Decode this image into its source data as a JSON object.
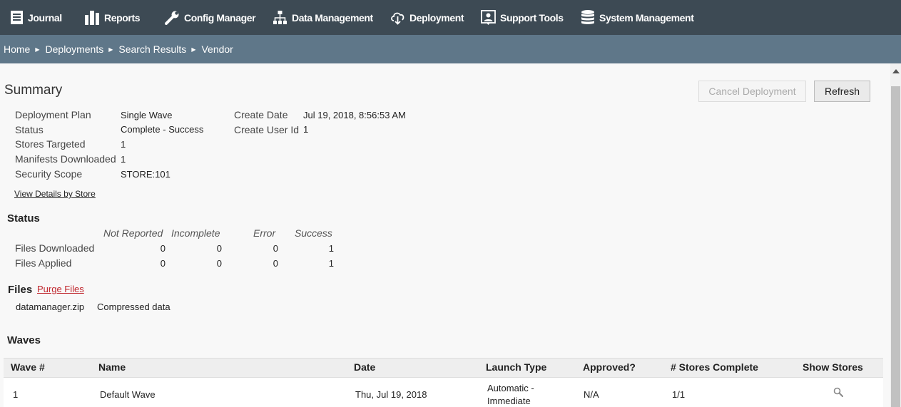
{
  "nav": {
    "items": [
      {
        "label": "Journal",
        "icon": "journal-icon"
      },
      {
        "label": "Reports",
        "icon": "reports-icon"
      },
      {
        "label": "Config Manager",
        "icon": "wrench-icon"
      },
      {
        "label": "Data Management",
        "icon": "hierarchy-icon"
      },
      {
        "label": "Deployment",
        "icon": "cloud-download-icon"
      },
      {
        "label": "Support Tools",
        "icon": "support-icon"
      },
      {
        "label": "System Management",
        "icon": "database-icon"
      }
    ]
  },
  "breadcrumb": [
    "Home",
    "Deployments",
    "Search Results",
    "Vendor"
  ],
  "summary": {
    "title": "Summary",
    "cancel_label": "Cancel Deployment",
    "refresh_label": "Refresh",
    "fields": [
      {
        "label": "Deployment Plan",
        "value": "Single Wave"
      },
      {
        "label": "Status",
        "value": "Complete - Success"
      },
      {
        "label": "Stores Targeted",
        "value": "1"
      },
      {
        "label": "Manifests Downloaded",
        "value": "1"
      },
      {
        "label": "Security Scope",
        "value": "STORE:101"
      }
    ],
    "fields_right": [
      {
        "label": "Create Date",
        "value": "Jul 19, 2018, 8:56:53 AM"
      },
      {
        "label": "Create User Id",
        "value": "1"
      }
    ],
    "view_details_label": "View Details by Store"
  },
  "status": {
    "title": "Status",
    "columns": [
      "Not Reported",
      "Incomplete",
      "Error",
      "Success"
    ],
    "rows": [
      {
        "label": "Files Downloaded",
        "values": [
          "0",
          "0",
          "0",
          "1"
        ]
      },
      {
        "label": "Files Applied",
        "values": [
          "0",
          "0",
          "0",
          "1"
        ]
      }
    ]
  },
  "files": {
    "title": "Files",
    "purge_label": "Purge Files",
    "items": [
      {
        "name": "datamanager.zip",
        "description": "Compressed data"
      }
    ]
  },
  "waves": {
    "title": "Waves",
    "columns": [
      "Wave #",
      "Name",
      "Date",
      "Launch Type",
      "Approved?",
      "# Stores Complete",
      "Show Stores"
    ],
    "rows": [
      {
        "wave": "1",
        "name": "Default Wave",
        "date": "Thu, Jul 19, 2018",
        "launch_type_line1": "Automatic -",
        "launch_type_line2": "Immediate",
        "approved": "N/A",
        "stores_complete": "1/1",
        "show_stores_icon": "search-icon"
      }
    ]
  }
}
